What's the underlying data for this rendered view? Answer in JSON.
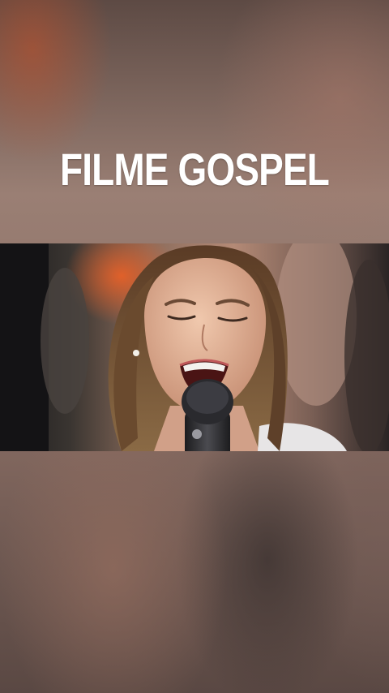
{
  "title": "FILME GOSPEL"
}
